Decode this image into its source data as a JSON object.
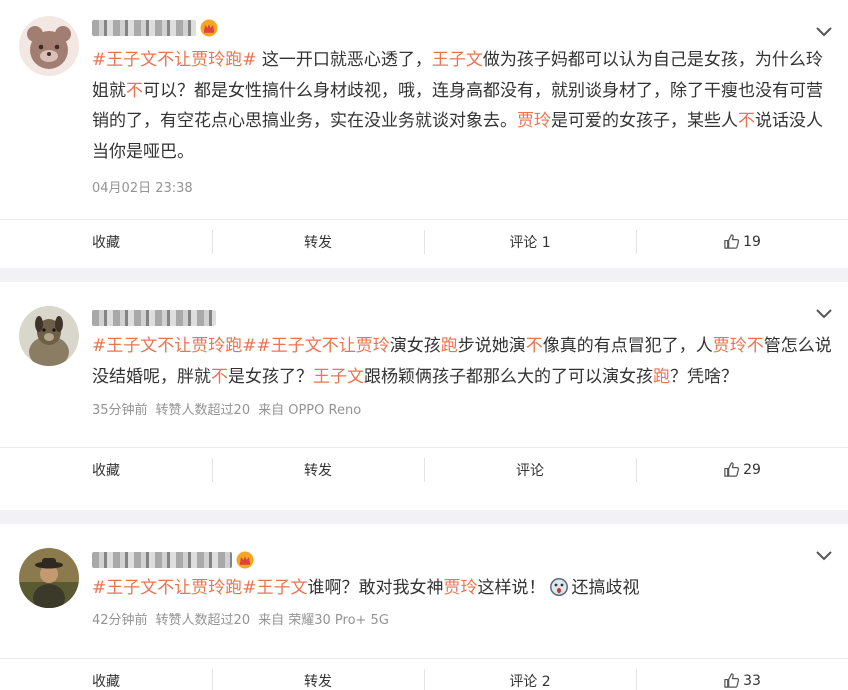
{
  "posts": [
    {
      "avatar": "bear-avatar",
      "has_crown": true,
      "segments": [
        {
          "t": "#王子文不让贾玲跑#",
          "c": "tag"
        },
        {
          "t": " 这一开口就恶心透了，",
          "c": ""
        },
        {
          "t": "王子文",
          "c": "hl"
        },
        {
          "t": "做为孩子妈都可以认为自己是女孩，为什么玲姐就",
          "c": ""
        },
        {
          "t": "不",
          "c": "hl"
        },
        {
          "t": "可以？都是女性搞什么身材歧视，哦，连身高都没有，就别谈身材了，除了干瘦也没有可营销的了，有空花点心思搞业务，实在没业务就谈对象去。",
          "c": ""
        },
        {
          "t": "贾玲",
          "c": "hl"
        },
        {
          "t": "是可爱的女孩子，某些人",
          "c": ""
        },
        {
          "t": "不",
          "c": "hl"
        },
        {
          "t": "说话没人当你是哑巴。",
          "c": ""
        }
      ],
      "meta": [
        "04月02日 23:38"
      ],
      "actions": {
        "fav": "收藏",
        "repost": "转发",
        "comment": "评论 1",
        "like": "19"
      }
    },
    {
      "avatar": "dog-avatar",
      "has_crown": false,
      "segments": [
        {
          "t": "#王子文不让贾玲跑#",
          "c": "tag"
        },
        {
          "t": "#王子文不让贾玲",
          "c": "tag"
        },
        {
          "t": "演女孩",
          "c": ""
        },
        {
          "t": "跑",
          "c": "hl"
        },
        {
          "t": "步说她演",
          "c": ""
        },
        {
          "t": "不",
          "c": "hl"
        },
        {
          "t": "像真的有点冒犯了，人",
          "c": ""
        },
        {
          "t": "贾玲不",
          "c": "hl"
        },
        {
          "t": "管怎么说没结婚呢，胖就",
          "c": ""
        },
        {
          "t": "不",
          "c": "hl"
        },
        {
          "t": "是女孩了？",
          "c": ""
        },
        {
          "t": "王子文",
          "c": "hl"
        },
        {
          "t": "跟杨颖俩孩子都那么大的了可以演女孩",
          "c": ""
        },
        {
          "t": "跑",
          "c": "hl"
        },
        {
          "t": "？凭啥？",
          "c": ""
        }
      ],
      "meta": [
        "35分钟前",
        "转赞人数超过20",
        "来自 OPPO Reno"
      ],
      "actions": {
        "fav": "收藏",
        "repost": "转发",
        "comment": "评论",
        "like": "29"
      }
    },
    {
      "avatar": "man-avatar",
      "has_crown": true,
      "segments": [
        {
          "t": "#王子文不让贾玲跑#",
          "c": "tag"
        },
        {
          "t": "王子文",
          "c": "hl"
        },
        {
          "t": "谁啊？敢对我女神",
          "c": ""
        },
        {
          "t": "贾玲",
          "c": "hl"
        },
        {
          "t": "这样说！",
          "c": ""
        },
        {
          "t": "[emoji]",
          "c": "emoji"
        },
        {
          "t": "还搞歧视",
          "c": ""
        }
      ],
      "meta": [
        "42分钟前",
        "转赞人数超过20",
        "来自 荣耀30 Pro+ 5G"
      ],
      "actions": {
        "fav": "收藏",
        "repost": "转发",
        "comment": "评论 2",
        "like": "33"
      }
    }
  ],
  "colors": {
    "highlight": "#eb7350",
    "tag": "#eb7350",
    "meta": "#939393",
    "bg": "#f2f2f5"
  }
}
